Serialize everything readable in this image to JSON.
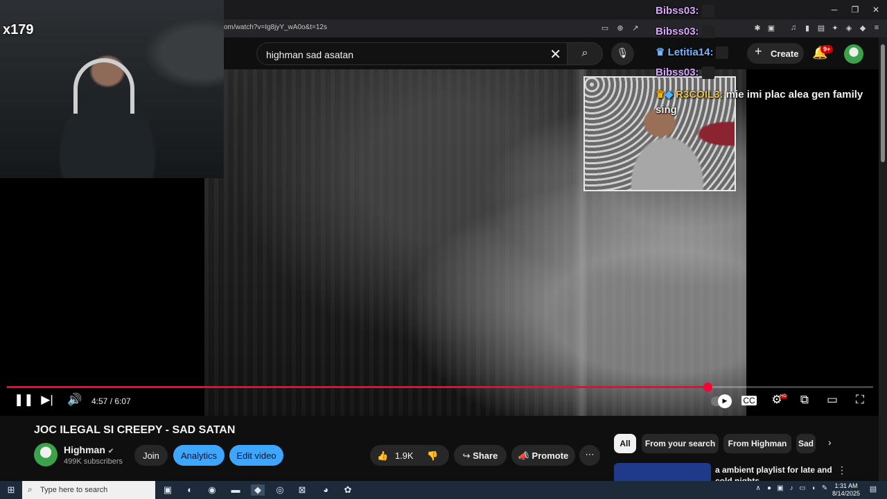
{
  "browser": {
    "url": "om/watch?v=Ig8jyY_wA0o&t=12s"
  },
  "header": {
    "search_value": "highman sad asatan",
    "create_label": "Create",
    "notifications_badge": "9+"
  },
  "overlay": {
    "streamer_tag": "x179",
    "chat": [
      {
        "user": "Bibss03:",
        "text": "",
        "color": "#d9a7ff"
      },
      {
        "user": "Bibss03:",
        "text": "",
        "color": "#d9a7ff"
      },
      {
        "user": "Letitia14:",
        "text": "",
        "color": "#6fb8ff"
      },
      {
        "user": "Bibss03:",
        "text": "",
        "color": "#d9a7ff"
      },
      {
        "user": "R3COIL3:",
        "text": "mie imi plac alea gen family",
        "text2": "sing",
        "color": "#e8c24a"
      }
    ]
  },
  "player": {
    "current_time": "4:57",
    "duration": "6:07",
    "time_display": "4:57 / 6:07",
    "progress_fraction": 0.809,
    "hd_badge": "HD"
  },
  "video": {
    "title": "JOC ILEGAL SI CREEPY - SAD SATAN",
    "channel": "Highman",
    "subscribers": "499K subscribers",
    "join_label": "Join",
    "analytics_label": "Analytics",
    "edit_label": "Edit video",
    "likes": "1.9K",
    "share_label": "Share",
    "promote_label": "Promote"
  },
  "chips": [
    "All",
    "From your search",
    "From Highman",
    "Sad"
  ],
  "recommendation": {
    "title": "a ambient playlist for late and cold nights"
  },
  "taskbar": {
    "search_placeholder": "Type here to search",
    "time": "1:31 AM",
    "date": "8/14/2025"
  },
  "colors": {
    "accent_red": "#ff0033",
    "accent_blue": "#3ea6ff",
    "background": "#0f0f0f"
  }
}
